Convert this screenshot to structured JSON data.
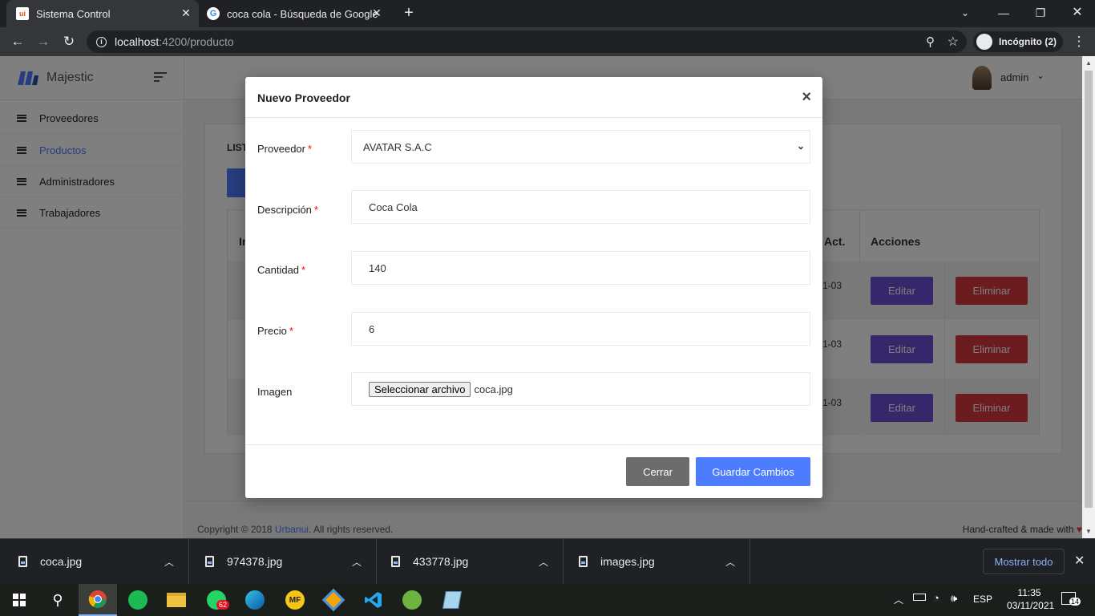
{
  "browser": {
    "tabs": [
      {
        "title": "Sistema Control",
        "favicon": "ui"
      },
      {
        "title": "coca cola - Búsqueda de Google",
        "favicon": "G"
      }
    ],
    "new_tab_icon": "+",
    "url_host": "localhost",
    "url_path": ":4200/producto",
    "incognito_label": "Incógnito (2)"
  },
  "app": {
    "brand": "Majestic",
    "user_name": "admin",
    "sidebar": [
      {
        "label": "Proveedores",
        "active": false
      },
      {
        "label": "Productos",
        "active": true
      },
      {
        "label": "Administradores",
        "active": false
      },
      {
        "label": "Trabajadores",
        "active": false
      }
    ],
    "card_title_fragment": "LIST",
    "table": {
      "header_left_fragment": "In",
      "header_act": "Act.",
      "header_actions": "Acciones",
      "rows": [
        {
          "date_fragment": "1-03",
          "edit": "Editar",
          "delete": "Eliminar"
        },
        {
          "date_fragment": "1-03",
          "edit": "Editar",
          "delete": "Eliminar"
        },
        {
          "date_fragment": "1-03",
          "edit": "Editar",
          "delete": "Eliminar"
        }
      ]
    },
    "footer": {
      "copyright_prefix": "Copyright © 2018 ",
      "copyright_link": "Urbanui",
      "copyright_suffix": ". All rights reserved.",
      "right_text": "Hand-crafted & made with"
    }
  },
  "modal": {
    "title": "Nuevo Proveedor",
    "close_glyph": "×",
    "fields": {
      "proveedor_label": "Proveedor",
      "proveedor_value": "AVATAR S.A.C",
      "descripcion_label": "Descripción",
      "descripcion_value": "Coca Cola",
      "cantidad_label": "Cantidad",
      "cantidad_value": "140",
      "precio_label": "Precio",
      "precio_value": "6",
      "imagen_label": "Imagen",
      "file_button": "Seleccionar archivo",
      "file_name": "coca.jpg"
    },
    "required_mark": "*",
    "close_button": "Cerrar",
    "save_button": "Guardar Cambios"
  },
  "downloads": {
    "items": [
      "coca.jpg",
      "974378.jpg",
      "433778.jpg",
      "images.jpg"
    ],
    "show_all": "Mostrar todo"
  },
  "taskbar": {
    "whatsapp_badge": "62",
    "lang": "ESP",
    "time": "11:35",
    "date": "03/11/2021",
    "notif_count": "14"
  },
  "colors": {
    "primary": "#4d7cfe",
    "edit_purple": "#6a4fd2",
    "delete_red": "#d8393d",
    "gray_button": "#6c6c6c"
  }
}
